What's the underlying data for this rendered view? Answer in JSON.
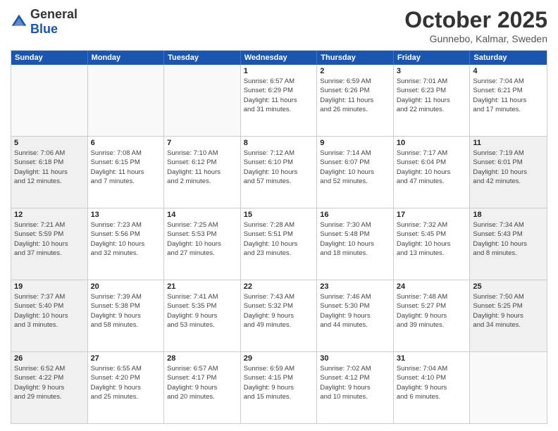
{
  "logo": {
    "general": "General",
    "blue": "Blue"
  },
  "title": "October 2025",
  "subtitle": "Gunnebo, Kalmar, Sweden",
  "header_days": [
    "Sunday",
    "Monday",
    "Tuesday",
    "Wednesday",
    "Thursday",
    "Friday",
    "Saturday"
  ],
  "weeks": [
    [
      {
        "day": "",
        "info": "",
        "empty": true
      },
      {
        "day": "",
        "info": "",
        "empty": true
      },
      {
        "day": "",
        "info": "",
        "empty": true
      },
      {
        "day": "1",
        "info": "Sunrise: 6:57 AM\nSunset: 6:29 PM\nDaylight: 11 hours\nand 31 minutes."
      },
      {
        "day": "2",
        "info": "Sunrise: 6:59 AM\nSunset: 6:26 PM\nDaylight: 11 hours\nand 26 minutes."
      },
      {
        "day": "3",
        "info": "Sunrise: 7:01 AM\nSunset: 6:23 PM\nDaylight: 11 hours\nand 22 minutes."
      },
      {
        "day": "4",
        "info": "Sunrise: 7:04 AM\nSunset: 6:21 PM\nDaylight: 11 hours\nand 17 minutes."
      }
    ],
    [
      {
        "day": "5",
        "info": "Sunrise: 7:06 AM\nSunset: 6:18 PM\nDaylight: 11 hours\nand 12 minutes.",
        "shaded": true
      },
      {
        "day": "6",
        "info": "Sunrise: 7:08 AM\nSunset: 6:15 PM\nDaylight: 11 hours\nand 7 minutes."
      },
      {
        "day": "7",
        "info": "Sunrise: 7:10 AM\nSunset: 6:12 PM\nDaylight: 11 hours\nand 2 minutes."
      },
      {
        "day": "8",
        "info": "Sunrise: 7:12 AM\nSunset: 6:10 PM\nDaylight: 10 hours\nand 57 minutes."
      },
      {
        "day": "9",
        "info": "Sunrise: 7:14 AM\nSunset: 6:07 PM\nDaylight: 10 hours\nand 52 minutes."
      },
      {
        "day": "10",
        "info": "Sunrise: 7:17 AM\nSunset: 6:04 PM\nDaylight: 10 hours\nand 47 minutes."
      },
      {
        "day": "11",
        "info": "Sunrise: 7:19 AM\nSunset: 6:01 PM\nDaylight: 10 hours\nand 42 minutes.",
        "shaded": true
      }
    ],
    [
      {
        "day": "12",
        "info": "Sunrise: 7:21 AM\nSunset: 5:59 PM\nDaylight: 10 hours\nand 37 minutes.",
        "shaded": true
      },
      {
        "day": "13",
        "info": "Sunrise: 7:23 AM\nSunset: 5:56 PM\nDaylight: 10 hours\nand 32 minutes."
      },
      {
        "day": "14",
        "info": "Sunrise: 7:25 AM\nSunset: 5:53 PM\nDaylight: 10 hours\nand 27 minutes."
      },
      {
        "day": "15",
        "info": "Sunrise: 7:28 AM\nSunset: 5:51 PM\nDaylight: 10 hours\nand 23 minutes."
      },
      {
        "day": "16",
        "info": "Sunrise: 7:30 AM\nSunset: 5:48 PM\nDaylight: 10 hours\nand 18 minutes."
      },
      {
        "day": "17",
        "info": "Sunrise: 7:32 AM\nSunset: 5:45 PM\nDaylight: 10 hours\nand 13 minutes."
      },
      {
        "day": "18",
        "info": "Sunrise: 7:34 AM\nSunset: 5:43 PM\nDaylight: 10 hours\nand 8 minutes.",
        "shaded": true
      }
    ],
    [
      {
        "day": "19",
        "info": "Sunrise: 7:37 AM\nSunset: 5:40 PM\nDaylight: 10 hours\nand 3 minutes.",
        "shaded": true
      },
      {
        "day": "20",
        "info": "Sunrise: 7:39 AM\nSunset: 5:38 PM\nDaylight: 9 hours\nand 58 minutes."
      },
      {
        "day": "21",
        "info": "Sunrise: 7:41 AM\nSunset: 5:35 PM\nDaylight: 9 hours\nand 53 minutes."
      },
      {
        "day": "22",
        "info": "Sunrise: 7:43 AM\nSunset: 5:32 PM\nDaylight: 9 hours\nand 49 minutes."
      },
      {
        "day": "23",
        "info": "Sunrise: 7:46 AM\nSunset: 5:30 PM\nDaylight: 9 hours\nand 44 minutes."
      },
      {
        "day": "24",
        "info": "Sunrise: 7:48 AM\nSunset: 5:27 PM\nDaylight: 9 hours\nand 39 minutes."
      },
      {
        "day": "25",
        "info": "Sunrise: 7:50 AM\nSunset: 5:25 PM\nDaylight: 9 hours\nand 34 minutes.",
        "shaded": true
      }
    ],
    [
      {
        "day": "26",
        "info": "Sunrise: 6:52 AM\nSunset: 4:22 PM\nDaylight: 9 hours\nand 29 minutes.",
        "shaded": true
      },
      {
        "day": "27",
        "info": "Sunrise: 6:55 AM\nSunset: 4:20 PM\nDaylight: 9 hours\nand 25 minutes."
      },
      {
        "day": "28",
        "info": "Sunrise: 6:57 AM\nSunset: 4:17 PM\nDaylight: 9 hours\nand 20 minutes."
      },
      {
        "day": "29",
        "info": "Sunrise: 6:59 AM\nSunset: 4:15 PM\nDaylight: 9 hours\nand 15 minutes."
      },
      {
        "day": "30",
        "info": "Sunrise: 7:02 AM\nSunset: 4:12 PM\nDaylight: 9 hours\nand 10 minutes."
      },
      {
        "day": "31",
        "info": "Sunrise: 7:04 AM\nSunset: 4:10 PM\nDaylight: 9 hours\nand 6 minutes."
      },
      {
        "day": "",
        "info": "",
        "empty": true
      }
    ]
  ]
}
